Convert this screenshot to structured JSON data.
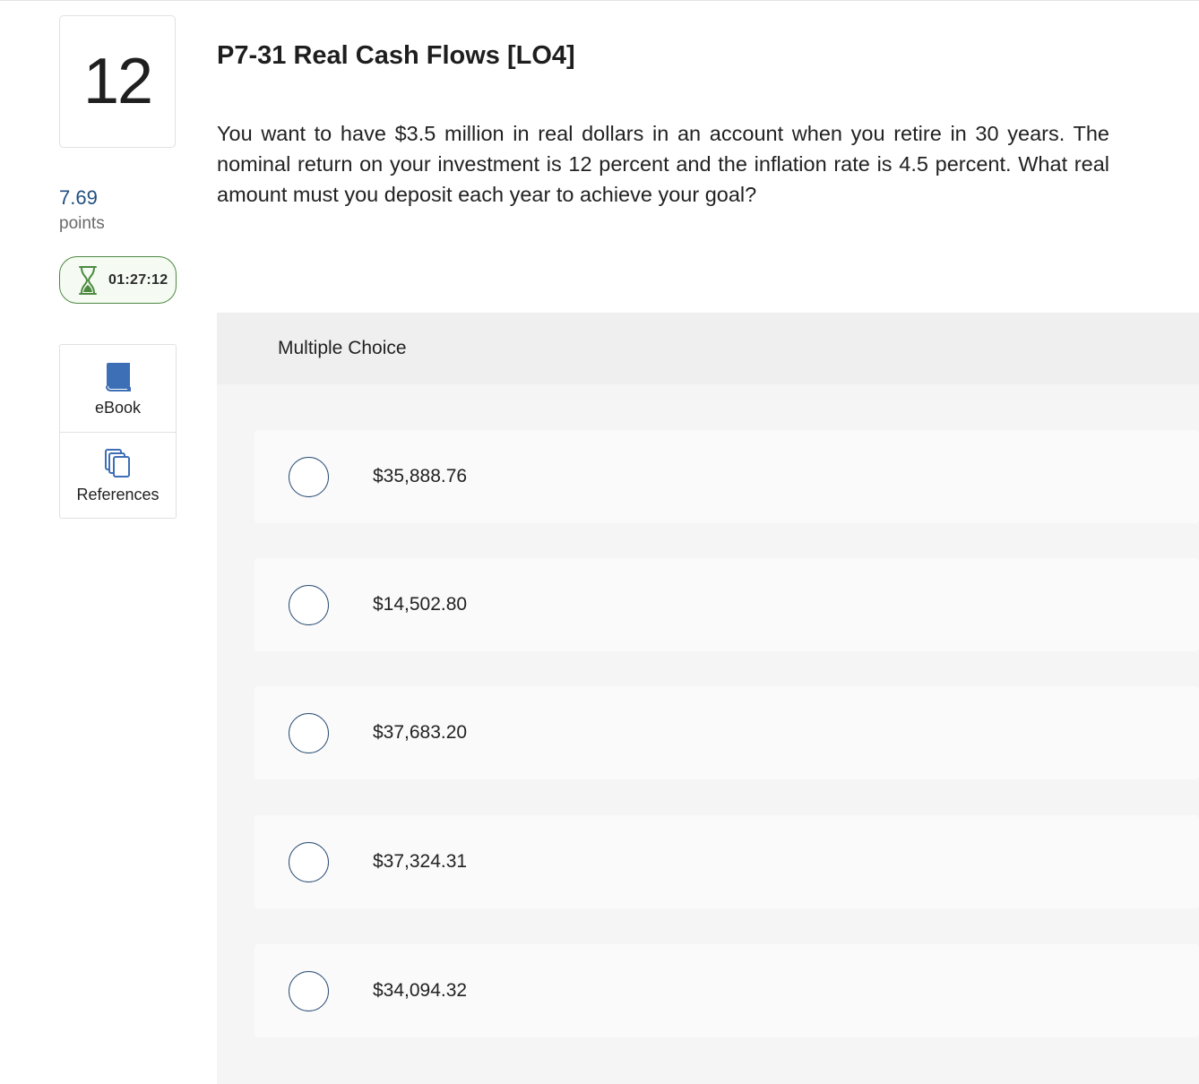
{
  "question": {
    "number": "12",
    "points_value": "7.69",
    "points_label": "points",
    "timer": "01:27:12",
    "title": "P7-31 Real Cash Flows [LO4]",
    "body": "You want to have $3.5 million in real dollars in an account when you retire in 30 years. The nominal return on your investment is 12 percent and the inflation rate is 4.5 percent. What real amount must you deposit each year to achieve your goal?"
  },
  "tools": {
    "ebook_label": "eBook",
    "references_label": "References"
  },
  "multiple_choice": {
    "header": "Multiple Choice",
    "options": [
      {
        "label": "$35,888.76"
      },
      {
        "label": "$14,502.80"
      },
      {
        "label": "$37,683.20"
      },
      {
        "label": "$37,324.31"
      },
      {
        "label": "$34,094.32"
      }
    ]
  },
  "colors": {
    "accent_blue": "#1f4f7f",
    "timer_green": "#4b8a3f",
    "radio_border": "#2a4d74",
    "ebook_icon": "#3d6fb6"
  },
  "icons": {
    "timer": "hourglass-icon",
    "ebook": "book-icon",
    "references": "copy-pages-icon"
  }
}
